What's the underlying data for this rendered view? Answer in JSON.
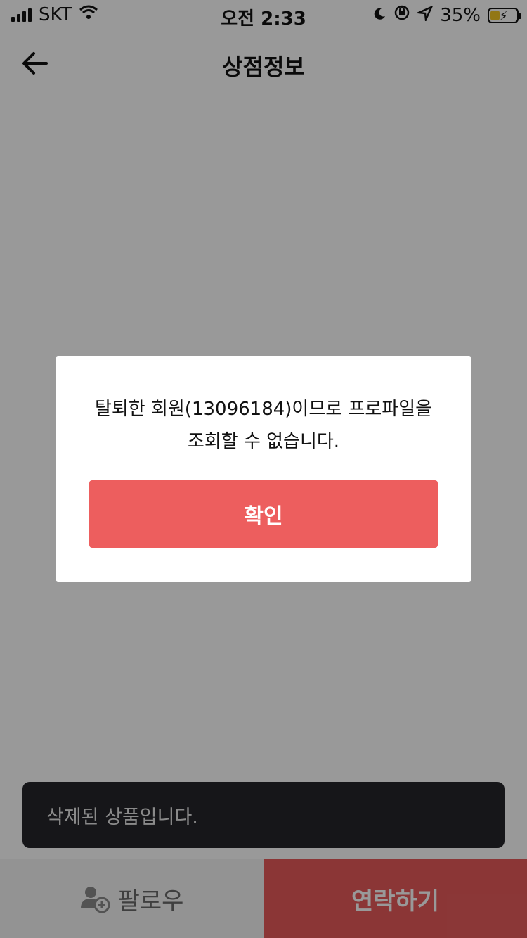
{
  "status_bar": {
    "carrier": "SKT",
    "time": "오전 2:33",
    "battery_percent_label": "35%",
    "battery_level": 0.35,
    "icons": [
      "signal-bars-icon",
      "wifi-icon",
      "moon-icon",
      "orientation-lock-icon",
      "location-arrow-icon",
      "battery-charging-icon"
    ]
  },
  "header": {
    "title": "상점정보",
    "back_icon": "arrow-left-icon"
  },
  "bottom_bar": {
    "follow_label": "팔로우",
    "follow_icon": "user-add-icon",
    "contact_label": "연락하기"
  },
  "toast": {
    "message": "삭제된 상품입니다."
  },
  "modal": {
    "message_line1": "탈퇴한 회원(13096184)이므로 프로파일을",
    "message_line2": "조회할 수 없습니다.",
    "confirm_label": "확인"
  },
  "colors": {
    "accent": "#ED5E5E",
    "overlay": "rgba(0,0,0,0.4)",
    "toast_bg": "#26262B"
  }
}
